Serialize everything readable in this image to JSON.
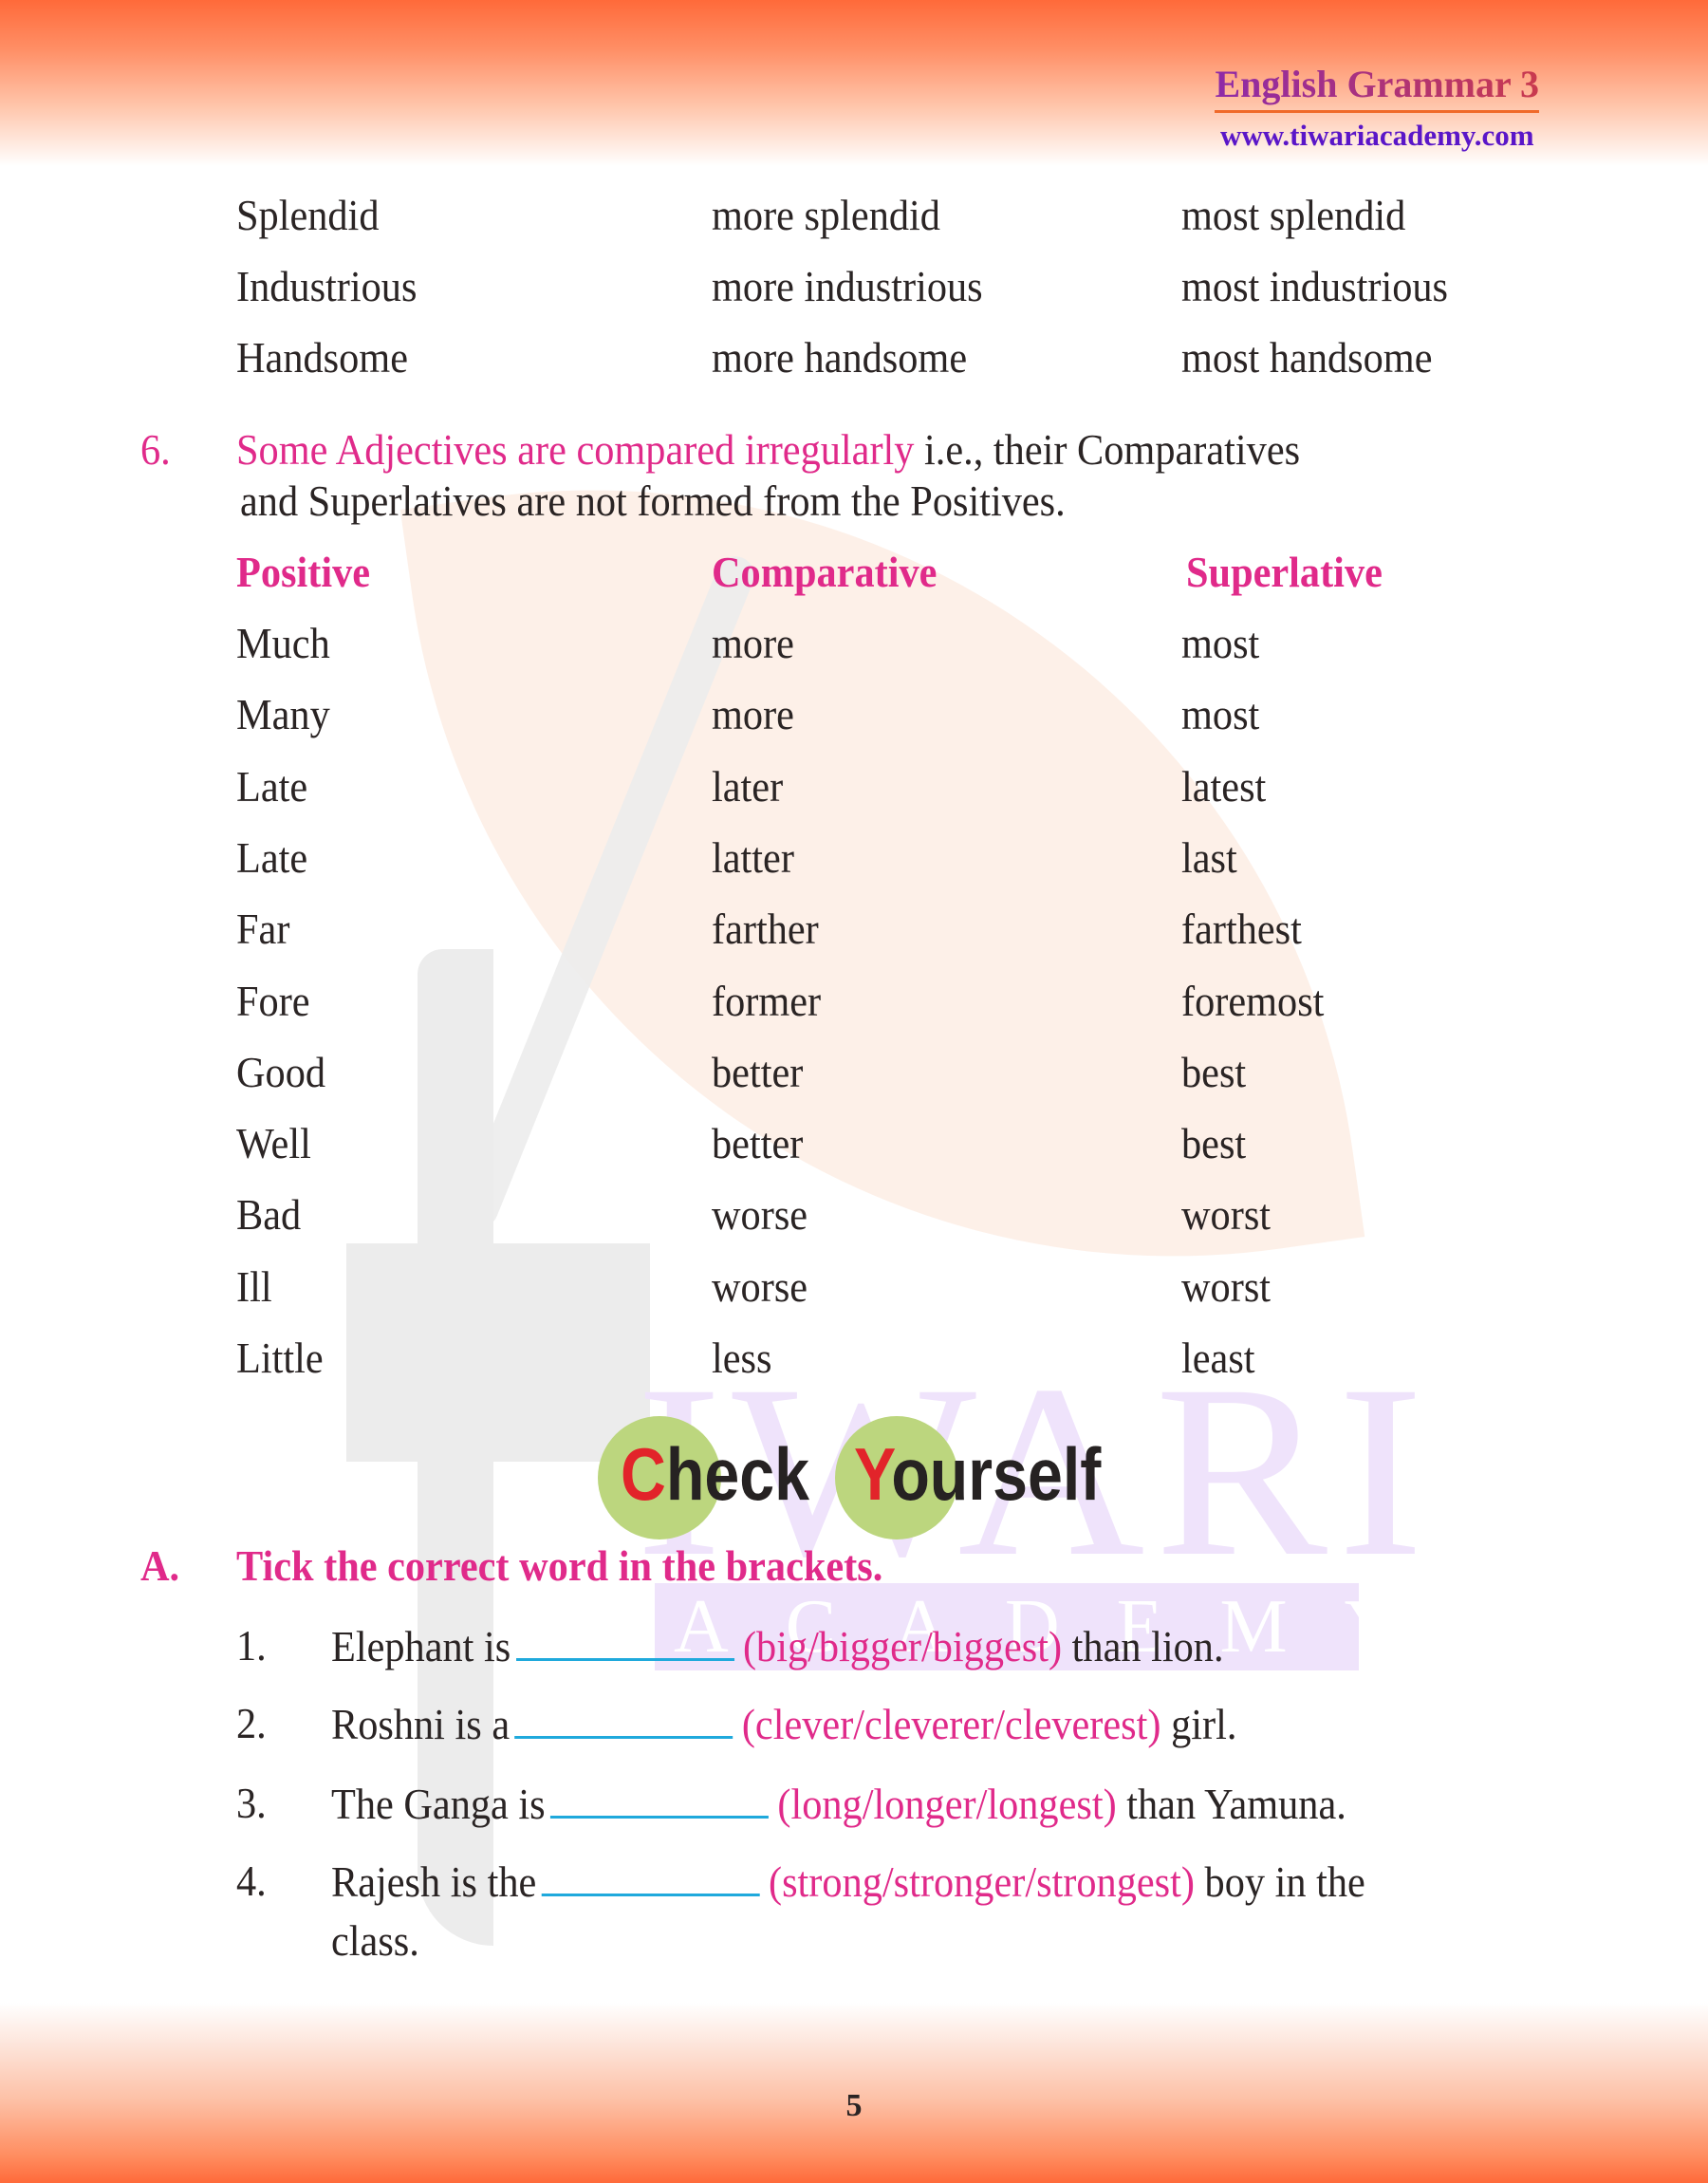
{
  "header": {
    "title": "English Grammar 3",
    "url": "www.tiwariacademy.com"
  },
  "top_table": {
    "rows": [
      [
        "Splendid",
        "more splendid",
        "most splendid"
      ],
      [
        "Industrious",
        "more industrious",
        "most industrious"
      ],
      [
        "Handsome",
        "more handsome",
        "most handsome"
      ]
    ]
  },
  "section6": {
    "number": "6.",
    "highlight": "Some Adjectives are compared irregularly",
    "rest_line1": " i.e., their Comparatives",
    "line2": "and Superlatives are not formed from the Positives.",
    "headers": [
      "Positive",
      "Comparative",
      "Superlative"
    ],
    "rows": [
      [
        "Much",
        "more",
        "most"
      ],
      [
        "Many",
        "more",
        "most"
      ],
      [
        "Late",
        "later",
        "latest"
      ],
      [
        "Late",
        "latter",
        "last"
      ],
      [
        "Far",
        "farther",
        "farthest"
      ],
      [
        "Fore",
        "former",
        "foremost"
      ],
      [
        "Good",
        "better",
        "best"
      ],
      [
        "Well",
        "better",
        "best"
      ],
      [
        "Bad",
        "worse",
        "worst"
      ],
      [
        "Ill",
        "worse",
        "worst"
      ],
      [
        "Little",
        "less",
        "least"
      ]
    ]
  },
  "check_yourself": {
    "word1_cap": "C",
    "word1_rest": "heck",
    "word2_cap": "Y",
    "word2_rest": "ourself"
  },
  "exercise": {
    "label": "A.",
    "instruction": "Tick the correct word in the brackets.",
    "items": [
      {
        "num": "1.",
        "before": "Elephant is",
        "options": "(big/bigger/biggest)",
        "after": "than lion."
      },
      {
        "num": "2.",
        "before": "Roshni is a",
        "options": "(clever/cleverer/cleverest)",
        "after": "girl."
      },
      {
        "num": "3.",
        "before": "The Ganga is",
        "options": "(long/longer/longest)",
        "after": "than Yamuna."
      },
      {
        "num": "4.",
        "before": "Rajesh is the",
        "options": "(strong/stronger/strongest)",
        "after": "boy in the"
      }
    ],
    "item4_continuation": "class."
  },
  "watermark": {
    "big": "IWARI",
    "small": "ACADEMY"
  },
  "page_number": "5",
  "colors": {
    "accent_pink": "#e02a8a",
    "blank_line": "#1fa9dc",
    "check_red": "#e2242a",
    "check_green": "#bcd67e"
  }
}
